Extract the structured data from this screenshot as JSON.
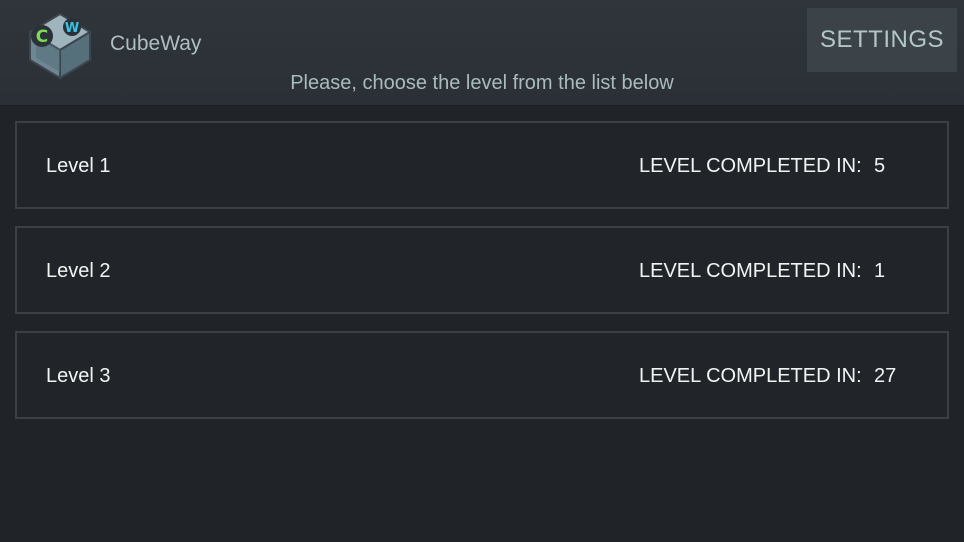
{
  "header": {
    "app_title": "CubeWay",
    "logo_icon": "cubeway-logo-icon",
    "logo_letters": [
      "C",
      "W"
    ],
    "settings_label": "SETTINGS",
    "subtitle": "Please, choose the level from the list below"
  },
  "levels": [
    {
      "name": "Level 1",
      "status_label": "LEVEL COMPLETED IN:",
      "value": "5"
    },
    {
      "name": "Level 2",
      "status_label": "LEVEL COMPLETED IN:",
      "value": "1"
    },
    {
      "name": "Level 3",
      "status_label": "LEVEL COMPLETED IN:",
      "value": "27"
    }
  ],
  "colors": {
    "background": "#202428",
    "header": "#2f353b",
    "settings_button": "#3b4248",
    "row_border": "#3a4045"
  }
}
